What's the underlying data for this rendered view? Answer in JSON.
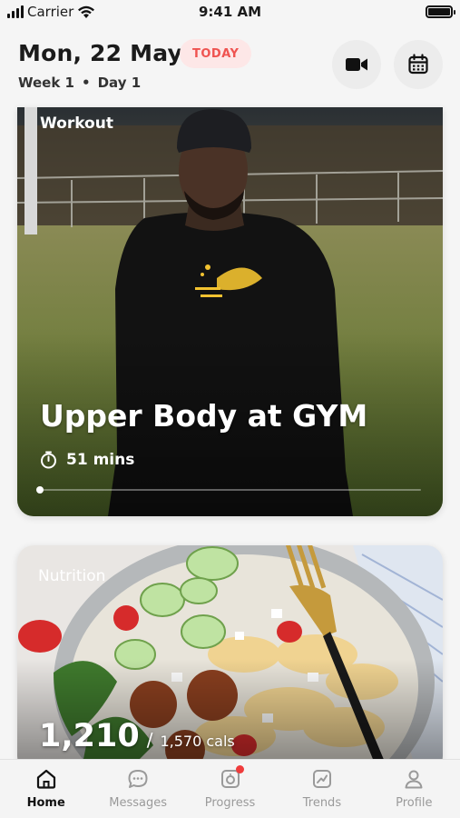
{
  "status_bar": {
    "carrier": "Carrier",
    "time": "9:41 AM"
  },
  "header": {
    "date": "Mon, 22 May",
    "today_badge": "TODAY",
    "week": "Week 1",
    "separator": "•",
    "day": "Day 1",
    "buttons": [
      {
        "icon": "video-camera-icon"
      },
      {
        "icon": "calendar-icon"
      }
    ]
  },
  "workout": {
    "label": "Workout",
    "title": "Upper Body at GYM",
    "duration": "51 mins",
    "progress": 0.0
  },
  "nutrition": {
    "label": "Nutrition",
    "calories_current": "1,210",
    "slash": "/",
    "calories_total": "1,570 cals"
  },
  "tab_bar": {
    "tabs": [
      {
        "label": "Home",
        "icon": "home-icon",
        "active": true
      },
      {
        "label": "Messages",
        "icon": "chat-bubble-icon",
        "active": false
      },
      {
        "label": "Progress",
        "icon": "camera-progress-icon",
        "active": false,
        "badge": true
      },
      {
        "label": "Trends",
        "icon": "trend-chart-icon",
        "active": false
      },
      {
        "label": "Profile",
        "icon": "person-icon",
        "active": false
      }
    ]
  },
  "colors": {
    "accent_red": "#ef5350",
    "badge_bg": "#fde7e7",
    "tab_inactive": "#9a9a9a"
  }
}
